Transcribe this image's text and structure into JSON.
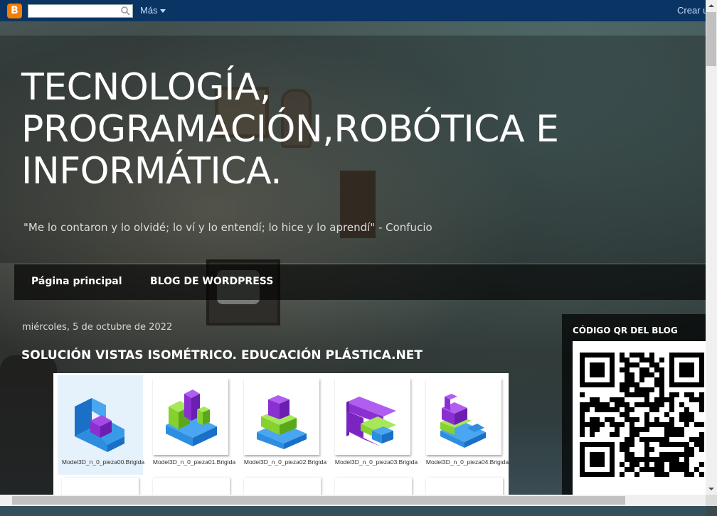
{
  "navbar": {
    "logo_letter": "B",
    "search_placeholder": "",
    "more_label": "Más",
    "create_label": "Crear u"
  },
  "header": {
    "title": "TECNOLOGÍA, PROGRAMACIÓN,ROBÓTICA E INFORMÁTICA.",
    "description": "\"Me lo contaron y lo olvidé; lo ví y lo entendí; lo hice y lo aprendí\" - Confucio"
  },
  "tabs": [
    {
      "label": "Página principal"
    },
    {
      "label": "BLOG DE WORDPRESS"
    }
  ],
  "post": {
    "date": "miércoles, 5 de octubre de 2022",
    "title": "SOLUCIÓN VISTAS ISOMÉTRICO. EDUCACIÓN PLÁSTICA.NET",
    "thumbnails": [
      {
        "label": "Model3D_n_0_pieza00.Brigida",
        "selected": true
      },
      {
        "label": "Model3D_n_0_pieza01.Brigida",
        "selected": false
      },
      {
        "label": "Model3D_n_0_pieza02.Brigida",
        "selected": false
      },
      {
        "label": "Model3D_n_0_pieza03.Brigida",
        "selected": false
      },
      {
        "label": "Model3D_n_0_pieza04.Brigida",
        "selected": false
      }
    ]
  },
  "sidebar": {
    "qr_title": "CÓDIGO QR DEL BLOG"
  },
  "colors": {
    "navbar": "#0a3464",
    "blogger_orange": "#f57d00",
    "blue_block": "#2d8ee0",
    "purple_block": "#8a2fd0",
    "green_block": "#86d12e"
  }
}
